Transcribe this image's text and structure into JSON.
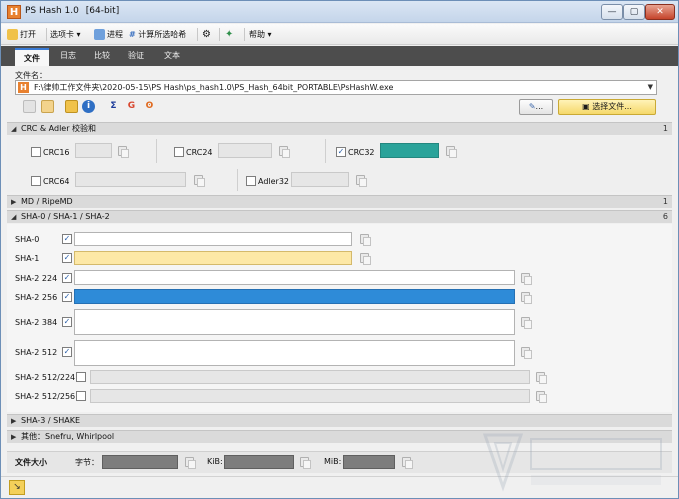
{
  "window": {
    "app_icon_letter": "H",
    "title": "PS Hash 1.0",
    "arch": "[64-bit]",
    "controls": {
      "minimize": "—",
      "maximize": "▢",
      "close": "✕"
    }
  },
  "toolbar": {
    "open": "打开",
    "options": "选项卡",
    "progress": "进程",
    "compute": "计算所选哈希",
    "help": "帮助"
  },
  "tabs": [
    "文件",
    "日志",
    "比较",
    "验证",
    "文本"
  ],
  "file": {
    "label": "文件名：",
    "path": "F:\\律帅工作文件夹\\2020-05-15\\PS Hash\\ps_hash1.0\\PS_Hash_64bit_PORTABLE\\PsHashW.exe",
    "edit_btn_suffix": "...",
    "choose_btn": "选择文件..."
  },
  "icon_names": [
    "copy-icon",
    "paste-icon",
    "folder-icon",
    "info-icon",
    "sigma-icon",
    "google-icon",
    "virustotal-icon"
  ],
  "sections": {
    "crc": {
      "title": "CRC & Adler 校验和",
      "count": "1"
    },
    "md": {
      "title": "MD / RipeMD",
      "count": "1"
    },
    "sha": {
      "title": "SHA-0 / SHA-1 / SHA-2",
      "count": "6"
    },
    "sha3": {
      "title": "SHA-3 / SHAKE"
    },
    "other": {
      "title": "其他：Snefru, Whirlpool"
    }
  },
  "crc_items": [
    {
      "label": "CRC16",
      "checked": false
    },
    {
      "label": "CRC24",
      "checked": false
    },
    {
      "label": "CRC32",
      "checked": true
    },
    {
      "label": "CRC64",
      "checked": false
    },
    {
      "label": "Adler32",
      "checked": false
    }
  ],
  "checkmark": "✓",
  "sha_items": [
    {
      "label": "SHA-0",
      "checked": true
    },
    {
      "label": "SHA-1",
      "checked": true
    },
    {
      "label": "SHA-2 224",
      "checked": true
    },
    {
      "label": "SHA-2 256",
      "checked": true
    },
    {
      "label": "SHA-2 384",
      "checked": true
    },
    {
      "label": "SHA-2 512",
      "checked": true
    },
    {
      "label": "SHA-2 512/224",
      "checked": false
    },
    {
      "label": "SHA-2 512/256",
      "checked": false
    }
  ],
  "footer": {
    "size_label": "文件大小",
    "bytes_label": "字节：",
    "kib_label": "KiB:",
    "mib_label": "MiB:"
  },
  "status": {
    "resize_glyph": "↘"
  },
  "colors": {
    "accent_tab": "#3a7bd5",
    "crc32_fill": "#2aa39a",
    "sha1_fill": "#fde8a6",
    "sha256_fill": "#2e8bd8",
    "choose_btn": "#f5d86a"
  }
}
